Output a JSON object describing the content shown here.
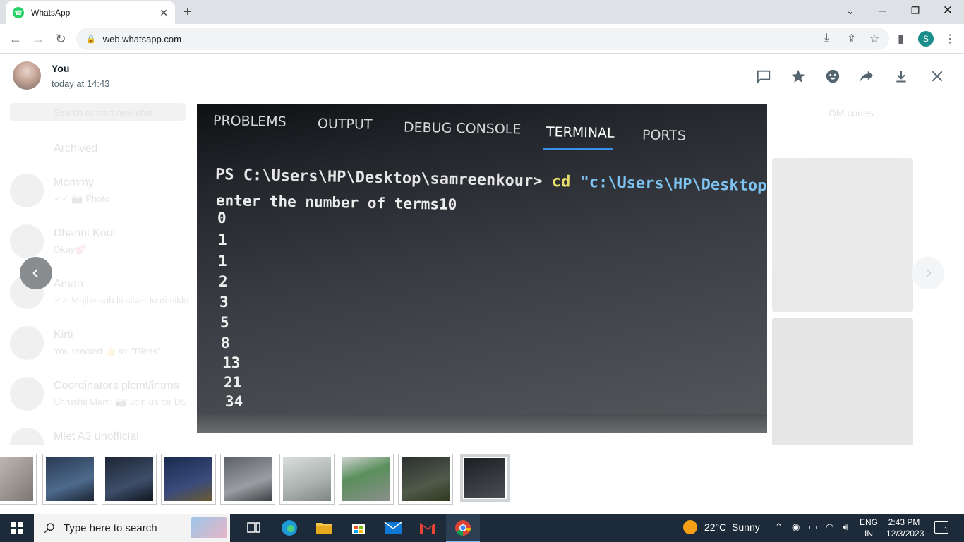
{
  "browser": {
    "tab_title": "WhatsApp",
    "url": "web.whatsapp.com",
    "profile_initial": "S"
  },
  "viewer": {
    "sender_name": "You",
    "sender_time": "today at 14:43",
    "actions": [
      "message-icon",
      "star-icon",
      "emoji-icon",
      "forward-icon",
      "download-icon",
      "close-icon"
    ]
  },
  "background": {
    "search_placeholder": "Search or start new chat",
    "archived": "Archived",
    "chats": [
      {
        "name": "Mommy",
        "preview": "✓✓ 📷 Photo"
      },
      {
        "name": "Dhanni Koul",
        "preview": "Okay💕"
      },
      {
        "name": "Aman",
        "preview": "✓✓ Mujhe sab ki silver tu di nikle"
      },
      {
        "name": "Kirti",
        "preview": "You reacted 👍 to: \"Bless\""
      },
      {
        "name": "Coordinators plcmt/intrns",
        "preview": "Shrushti Mam: 📷 Join us for DS"
      },
      {
        "name": "Miet A3 unofficial",
        "preview": ""
      }
    ],
    "right_header": "OM codes"
  },
  "photo": {
    "tabs": [
      "PROBLEMS",
      "OUTPUT",
      "DEBUG CONSOLE",
      "TERMINAL",
      "PORTS"
    ],
    "active_tab": "TERMINAL",
    "prompt": "PS C:\\Users\\HP\\Desktop\\samreenkour>",
    "command": "cd",
    "command_path": "\"c:\\Users\\HP\\Desktop\\sa",
    "input_line": "enter the number of terms10",
    "output": [
      "0",
      "1",
      "1",
      "2",
      "3",
      "5",
      "8",
      "13",
      "21",
      "34"
    ]
  },
  "thumbnails": {
    "count": 9,
    "active_index": 8
  },
  "taskbar": {
    "search_placeholder": "Type here to search",
    "weather": "22°C  Sunny",
    "lang_top": "ENG",
    "lang_bottom": "IN",
    "time": "2:43 PM",
    "date": "12/3/2023",
    "notifications": "1"
  }
}
